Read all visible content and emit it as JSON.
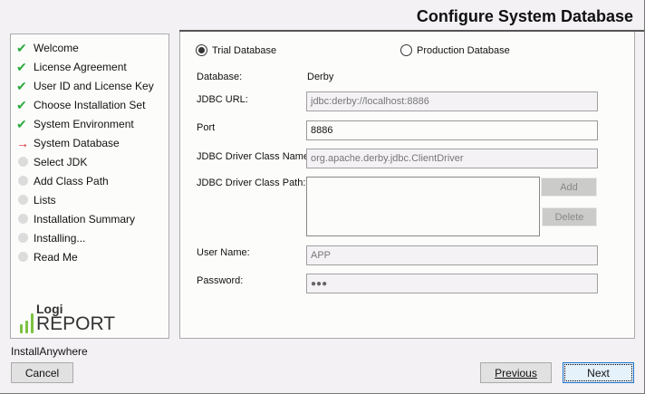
{
  "header": {
    "title": "Configure System Database"
  },
  "steps": [
    {
      "label": "Welcome",
      "status": "done"
    },
    {
      "label": "License Agreement",
      "status": "done"
    },
    {
      "label": "User ID and License Key",
      "status": "done"
    },
    {
      "label": "Choose Installation Set",
      "status": "done"
    },
    {
      "label": "System Environment",
      "status": "done"
    },
    {
      "label": "System Database",
      "status": "current"
    },
    {
      "label": "Select JDK",
      "status": "pending"
    },
    {
      "label": "Add Class Path",
      "status": "pending"
    },
    {
      "label": "Lists",
      "status": "pending"
    },
    {
      "label": "Installation Summary",
      "status": "pending"
    },
    {
      "label": "Installing...",
      "status": "pending"
    },
    {
      "label": "Read Me",
      "status": "pending"
    }
  ],
  "logo": {
    "line1": "Logi",
    "line2": "REPORT"
  },
  "form": {
    "trial_label": "Trial Database",
    "production_label": "Production Database",
    "selected": "trial",
    "database_label": "Database:",
    "database_value": "Derby",
    "url_label": "JDBC URL:",
    "url_value": "jdbc:derby://localhost:8886",
    "port_label": "Port",
    "port_value": "8886",
    "class_name_label": "JDBC Driver Class Name:",
    "class_name_value": "org.apache.derby.jdbc.ClientDriver",
    "class_path_label": "JDBC Driver Class Path:",
    "class_path_value": "",
    "add_label": "Add",
    "delete_label": "Delete",
    "user_label": "User Name:",
    "user_value": "APP",
    "password_label": "Password:",
    "password_value": "●●●"
  },
  "footer": {
    "vendor": "InstallAnywhere",
    "cancel": "Cancel",
    "previous": "Previous",
    "next": "Next"
  },
  "colors": {
    "done": "#2cab3e",
    "current": "#e0202a",
    "focus": "#1e73d0"
  }
}
